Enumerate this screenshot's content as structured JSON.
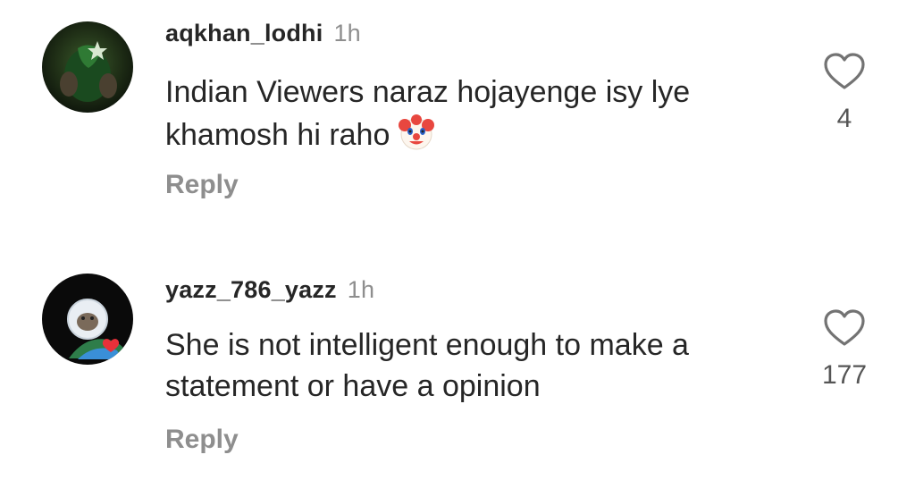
{
  "comments": [
    {
      "username": "aqkhan_lodhi",
      "time": "1h",
      "text": "Indian Viewers naraz hojayenge isy lye khamosh hi raho",
      "emoji": "clown-face-emoji",
      "like_count": "4",
      "reply_label": "Reply"
    },
    {
      "username": "yazz_786_yazz",
      "time": "1h",
      "text": "She is not intelligent enough to make a statement or have a opinion",
      "like_count": "177",
      "reply_label": "Reply"
    }
  ],
  "icons": {
    "like": "heart-outline-icon"
  },
  "colors": {
    "text_primary": "#262626",
    "text_secondary": "#8e8e8e",
    "background": "#ffffff"
  }
}
